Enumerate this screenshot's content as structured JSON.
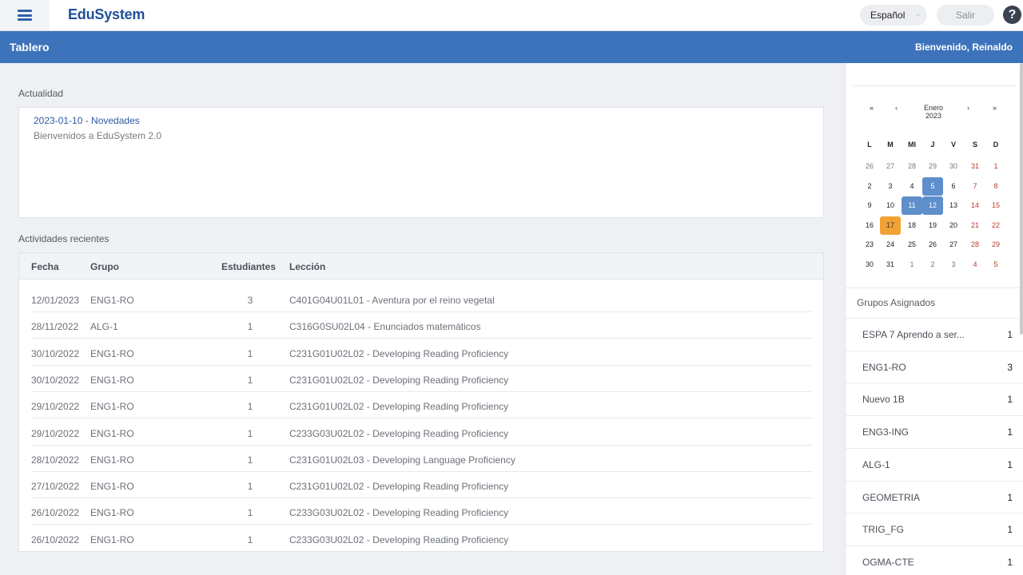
{
  "app": {
    "brand": "EduSystem"
  },
  "topbar": {
    "language": "Español",
    "logout_label": "Salir",
    "help_symbol": "?"
  },
  "header": {
    "title": "Tablero",
    "welcome": "Bienvenido, Reinaldo"
  },
  "news": {
    "section_title": "Actualidad",
    "items": [
      {
        "title": "2023-01-10 - Novedades",
        "body": "Bienvenidos a EduSystem 2.0"
      }
    ]
  },
  "activities": {
    "section_title": "Actividades recientes",
    "columns": [
      "Fecha",
      "Grupo",
      "Estudiantes",
      "Lección"
    ],
    "rows": [
      {
        "date": "12/01/2023",
        "group": "ENG1-RO",
        "students": "3",
        "lesson": "C401G04U01L01 - Aventura por el reino vegetal"
      },
      {
        "date": "28/11/2022",
        "group": "ALG-1",
        "students": "1",
        "lesson": "C316G0SU02L04 - Enunciados matemáticos"
      },
      {
        "date": "30/10/2022",
        "group": "ENG1-RO",
        "students": "1",
        "lesson": "C231G01U02L02 - Developing Reading Proficiency"
      },
      {
        "date": "30/10/2022",
        "group": "ENG1-RO",
        "students": "1",
        "lesson": "C231G01U02L02 - Developing Reading Proficiency"
      },
      {
        "date": "29/10/2022",
        "group": "ENG1-RO",
        "students": "1",
        "lesson": "C231G01U02L02 - Developing Reading Proficiency"
      },
      {
        "date": "29/10/2022",
        "group": "ENG1-RO",
        "students": "1",
        "lesson": "C233G03U02L02 - Developing Reading Proficiency"
      },
      {
        "date": "28/10/2022",
        "group": "ENG1-RO",
        "students": "1",
        "lesson": "C231G01U02L03 - Developing Language Proficiency"
      },
      {
        "date": "27/10/2022",
        "group": "ENG1-RO",
        "students": "1",
        "lesson": "C231G01U02L02 - Developing Reading Proficiency"
      },
      {
        "date": "26/10/2022",
        "group": "ENG1-RO",
        "students": "1",
        "lesson": "C233G03U02L02 - Developing Reading Proficiency"
      },
      {
        "date": "26/10/2022",
        "group": "ENG1-RO",
        "students": "1",
        "lesson": "C233G03U02L02 - Developing Reading Proficiency"
      }
    ]
  },
  "calendar": {
    "month_label": "Enero 2023",
    "nav": {
      "prev_year": "«",
      "prev_month": "‹",
      "next_month": "›",
      "next_year": "»"
    },
    "weekdays": [
      "L",
      "M",
      "MI",
      "J",
      "V",
      "S",
      "D"
    ],
    "weeks": [
      [
        "26",
        "27",
        "28",
        "29",
        "30",
        "31",
        "1"
      ],
      [
        "2",
        "3",
        "4",
        "5",
        "6",
        "7",
        "8"
      ],
      [
        "9",
        "10",
        "11",
        "12",
        "13",
        "14",
        "15"
      ],
      [
        "16",
        "17",
        "18",
        "19",
        "20",
        "21",
        "22"
      ],
      [
        "23",
        "24",
        "25",
        "26",
        "27",
        "28",
        "29"
      ],
      [
        "30",
        "31",
        "1",
        "2",
        "3",
        "4",
        "5"
      ]
    ],
    "outside_month": [
      [
        0,
        0
      ],
      [
        0,
        1
      ],
      [
        0,
        2
      ],
      [
        0,
        3
      ],
      [
        0,
        4
      ],
      [
        0,
        5
      ],
      [
        5,
        2
      ],
      [
        5,
        3
      ],
      [
        5,
        4
      ],
      [
        5,
        5
      ],
      [
        5,
        6
      ]
    ],
    "highlighted_days": [
      "5",
      "11",
      "12"
    ],
    "today": "17"
  },
  "groups": {
    "section_title": "Grupos Asignados",
    "items": [
      {
        "name": "ESPA 7 Aprendo a ser...",
        "count": "1"
      },
      {
        "name": "ENG1-RO",
        "count": "3"
      },
      {
        "name": "Nuevo 1B",
        "count": "1"
      },
      {
        "name": "ENG3-ING",
        "count": "1"
      },
      {
        "name": "ALG-1",
        "count": "1"
      },
      {
        "name": "GEOMETRIA",
        "count": "1"
      },
      {
        "name": "TRIG_FG",
        "count": "1"
      },
      {
        "name": "OGMA-CTE",
        "count": "1"
      }
    ]
  },
  "colors": {
    "brand": "#1f4f98",
    "header": "#3d73bb",
    "highlight": "#5f8fcb",
    "today": "#f1a234",
    "weekend": "#c0392b"
  },
  "icons": {
    "menu": "hamburger-icon",
    "language_dropdown": "chevron-down-icon",
    "help": "help-icon"
  }
}
